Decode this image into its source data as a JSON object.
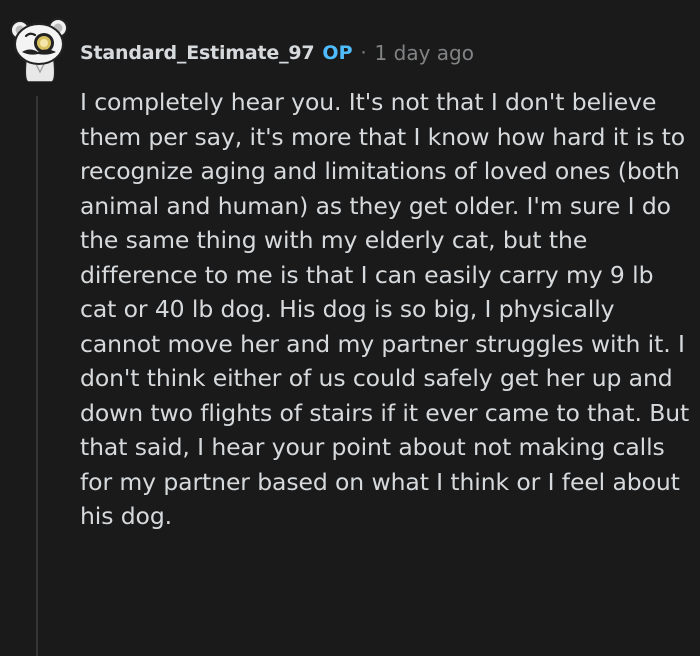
{
  "comment": {
    "author": "Standard_Estimate_97",
    "op_badge": "OP",
    "separator": "·",
    "timestamp": "1 day ago",
    "avatar_icon": "snoo-avatar-icon",
    "body": "I completely hear you. It's not that I don't believe them per say, it's more that I know how hard it is to recognize aging and limitations of loved ones (both animal and human) as they get older. I'm sure I do the same thing with my elderly cat, but the difference to me is that I can easily carry my 9 lb cat or 40 lb dog. His dog is so big, I physically cannot move her and my partner struggles with it. I don't think either of us could safely get her up and down two flights of stairs if it ever came to that. But that said, I hear your point about not making calls for my partner based on what I think or I feel about his dog."
  },
  "colors": {
    "background": "#1a1a1b",
    "text": "#d7dadc",
    "meta": "#818384",
    "op_badge": "#4fbcff",
    "thread_line": "#343536"
  }
}
